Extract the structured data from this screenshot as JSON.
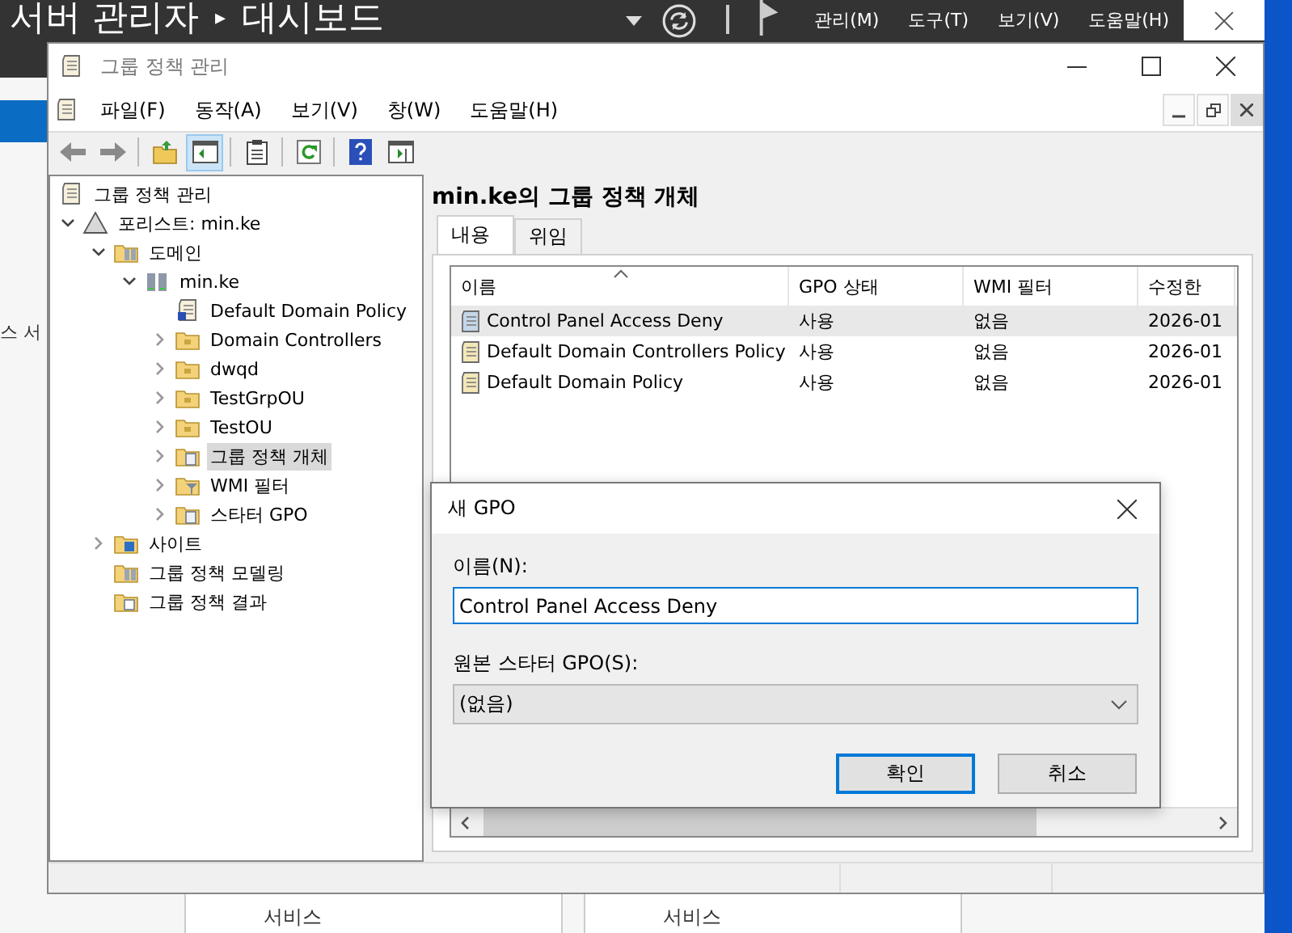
{
  "server_manager": {
    "title": "서버 관리자",
    "separator": "▸",
    "page": "대시보드",
    "menus": [
      "관리(M)",
      "도구(T)",
      "보기(V)",
      "도움말(H)"
    ],
    "side_text": "스 서",
    "bottom_texts": [
      "서비스",
      "서비스"
    ]
  },
  "window": {
    "title": "그룹 정책 관리",
    "menus": [
      "파일(F)",
      "동작(A)",
      "보기(V)",
      "창(W)",
      "도움말(H)"
    ],
    "tree": [
      {
        "label": "그룹 정책 관리",
        "kind": "console",
        "selected": false,
        "children": [
          {
            "label": "포리스트: min.ke",
            "kind": "forest",
            "expanded": true,
            "selected": false,
            "children": [
              {
                "label": "도메인",
                "kind": "domains",
                "expanded": true,
                "selected": false,
                "children": [
                  {
                    "label": "min.ke",
                    "kind": "domain",
                    "expanded": true,
                    "selected": false,
                    "children": [
                      {
                        "label": "Default Domain Policy",
                        "kind": "gpo-link",
                        "selected": false
                      },
                      {
                        "label": "Domain Controllers",
                        "kind": "ou",
                        "expanded": false,
                        "selected": false
                      },
                      {
                        "label": "dwqd",
                        "kind": "ou",
                        "expanded": false,
                        "selected": false
                      },
                      {
                        "label": "TestGrpOU",
                        "kind": "ou",
                        "expanded": false,
                        "selected": false
                      },
                      {
                        "label": "TestOU",
                        "kind": "ou",
                        "expanded": false,
                        "selected": false
                      },
                      {
                        "label": "그룹 정책 개체",
                        "kind": "gpo-folder",
                        "expanded": false,
                        "selected": true
                      },
                      {
                        "label": "WMI 필터",
                        "kind": "wmi",
                        "expanded": false,
                        "selected": false
                      },
                      {
                        "label": "스타터 GPO",
                        "kind": "starter",
                        "expanded": false,
                        "selected": false
                      }
                    ]
                  }
                ]
              },
              {
                "label": "사이트",
                "kind": "sites",
                "expanded": false,
                "selected": false
              },
              {
                "label": "그룹 정책 모델링",
                "kind": "modeling",
                "selected": false
              },
              {
                "label": "그룹 정책 결과",
                "kind": "results",
                "selected": false
              }
            ]
          }
        ]
      }
    ],
    "panel": {
      "heading": "min.ke의 그룹 정책 개체",
      "tabs": [
        {
          "label": "내용",
          "selected": true
        },
        {
          "label": "위임",
          "selected": false
        }
      ],
      "table": {
        "columns": [
          "이름",
          "GPO 상태",
          "WMI 필터",
          "수정한"
        ],
        "rows": [
          {
            "name": "Control Panel Access Deny",
            "status": "사용",
            "wmi": "없음",
            "modified": "2026-01",
            "selected": true
          },
          {
            "name": "Default Domain Controllers Policy",
            "status": "사용",
            "wmi": "없음",
            "modified": "2026-01",
            "selected": false
          },
          {
            "name": "Default Domain Policy",
            "status": "사용",
            "wmi": "없음",
            "modified": "2026-01",
            "selected": false
          }
        ]
      }
    }
  },
  "dialog": {
    "title": "새 GPO",
    "name_label": "이름(N):",
    "name_value": "Control Panel Access Deny",
    "starter_label": "원본 스타터 GPO(S):",
    "starter_value": "(없음)",
    "buttons": [
      {
        "label": "확인",
        "default": true
      },
      {
        "label": "취소",
        "default": false
      }
    ]
  }
}
